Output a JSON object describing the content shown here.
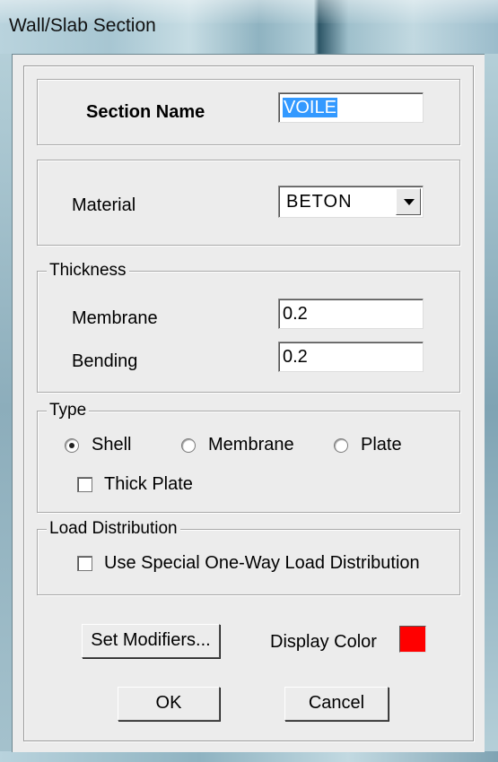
{
  "window": {
    "title": "Wall/Slab Section"
  },
  "section": {
    "label": "Section Name",
    "value": "VOILE"
  },
  "material": {
    "label": "Material",
    "value": "BETON"
  },
  "thickness": {
    "legend": "Thickness",
    "membrane_label": "Membrane",
    "membrane_value": "0.2",
    "bending_label": "Bending",
    "bending_value": "0.2"
  },
  "type": {
    "legend": "Type",
    "options": [
      {
        "label": "Shell",
        "selected": true
      },
      {
        "label": "Membrane",
        "selected": false
      },
      {
        "label": "Plate",
        "selected": false
      }
    ],
    "thick_plate_label": "Thick Plate",
    "thick_plate_checked": false
  },
  "load_distribution": {
    "legend": "Load Distribution",
    "option_label": "Use Special One-Way Load Distribution",
    "checked": false
  },
  "buttons": {
    "set_modifiers": "Set Modifiers...",
    "display_color_label": "Display Color",
    "ok": "OK",
    "cancel": "Cancel"
  },
  "colors": {
    "display_color": "#ff0000"
  }
}
